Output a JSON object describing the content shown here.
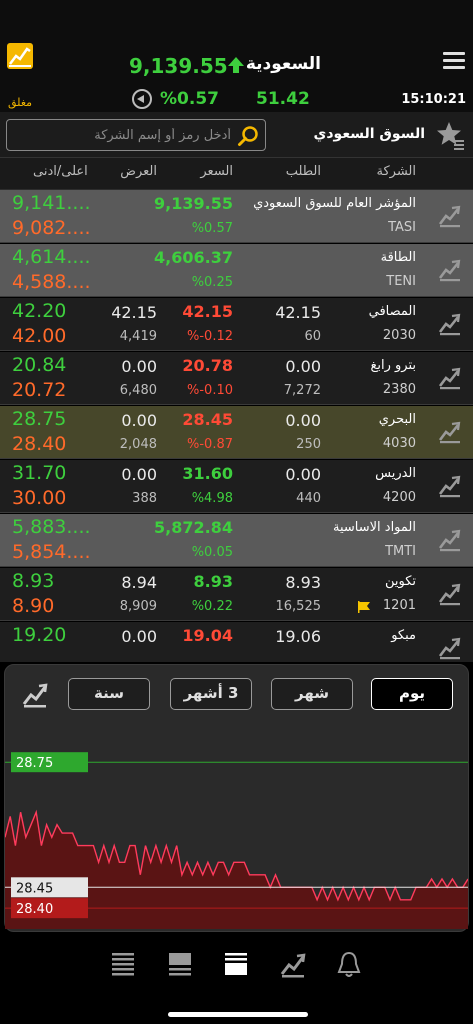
{
  "header": {
    "market_name": "السعودية",
    "index_value": "9,139.55",
    "status": "مغلق",
    "change_pct": "%0.57",
    "change_abs": "51.42",
    "time": "15:10:21"
  },
  "search": {
    "placeholder": "أدخل رمز أو إسم الشركة",
    "value": "",
    "market_selector": "السوق السعودي"
  },
  "columns": {
    "company": "الشركة",
    "bid": "الطلب",
    "price": "السعر",
    "ask": "العرض",
    "high_low": "اعلى/ادنى"
  },
  "rows": [
    {
      "name": "المؤشر العام للسوق السعودي",
      "code": "TASI",
      "bid": "",
      "bid_qty": "",
      "price": "9,139.55",
      "change": "%0.57",
      "ask": "",
      "ask_qty": "",
      "high": "9,141....",
      "low": "9,082....",
      "style": "idx",
      "dir": "up",
      "flag": false
    },
    {
      "name": "الطاقة",
      "code": "TENI",
      "bid": "",
      "bid_qty": "",
      "price": "4,606.37",
      "change": "%0.25",
      "ask": "",
      "ask_qty": "",
      "high": "4,614....",
      "low": "4,588....",
      "style": "idx",
      "dir": "up",
      "flag": false
    },
    {
      "name": "المصافي",
      "code": "2030",
      "bid": "42.15",
      "bid_qty": "60",
      "price": "42.15",
      "change": "%-0.12",
      "ask": "42.15",
      "ask_qty": "4,419",
      "high": "42.20",
      "low": "42.00",
      "style": "dark",
      "dir": "down",
      "flag": false
    },
    {
      "name": "بترو رابغ",
      "code": "2380",
      "bid": "0.00",
      "bid_qty": "7,272",
      "price": "20.78",
      "change": "%-0.10",
      "ask": "0.00",
      "ask_qty": "6,480",
      "high": "20.84",
      "low": "20.72",
      "style": "dark",
      "dir": "down",
      "flag": false
    },
    {
      "name": "البحري",
      "code": "4030",
      "bid": "0.00",
      "bid_qty": "250",
      "price": "28.45",
      "change": "%-0.87",
      "ask": "0.00",
      "ask_qty": "2,048",
      "high": "28.75",
      "low": "28.40",
      "style": "sel",
      "dir": "down",
      "flag": false
    },
    {
      "name": "الدريس",
      "code": "4200",
      "bid": "0.00",
      "bid_qty": "440",
      "price": "31.60",
      "change": "%4.98",
      "ask": "0.00",
      "ask_qty": "388",
      "high": "31.70",
      "low": "30.00",
      "style": "dark",
      "dir": "up",
      "flag": false
    },
    {
      "name": "المواد الاساسية",
      "code": "TMTI",
      "bid": "",
      "bid_qty": "",
      "price": "5,872.84",
      "change": "%0.05",
      "ask": "",
      "ask_qty": "",
      "high": "5,883....",
      "low": "5,854....",
      "style": "idx",
      "dir": "up",
      "flag": false
    },
    {
      "name": "تكوين",
      "code": "1201",
      "bid": "8.93",
      "bid_qty": "16,525",
      "price": "8.93",
      "change": "%0.22",
      "ask": "8.94",
      "ask_qty": "8,909",
      "high": "8.93",
      "low": "8.90",
      "style": "dark",
      "dir": "up",
      "flag": true
    },
    {
      "name": "مبكو",
      "code": "",
      "bid": "19.06",
      "bid_qty": "",
      "price": "19.04",
      "change": "",
      "ask": "0.00",
      "ask_qty": "",
      "high": "19.20",
      "low": "",
      "style": "dark",
      "dir": "down",
      "flag": false
    }
  ],
  "chart_panel": {
    "tabs": [
      "يوم",
      "شهر",
      "3 أشهر",
      "سنة"
    ],
    "active_tab": "يوم",
    "high_label": "28.75",
    "price_label": "28.45",
    "low_label": "28.40"
  },
  "chart_data": {
    "type": "area",
    "title": "",
    "xlabel": "",
    "ylabel": "",
    "ylim": [
      28.35,
      28.82
    ],
    "reference_lines": [
      28.75,
      28.45,
      28.4
    ],
    "values": [
      28.57,
      28.62,
      28.55,
      28.63,
      28.57,
      28.6,
      28.63,
      28.55,
      28.6,
      28.57,
      28.6,
      28.58,
      28.58,
      28.58,
      28.55,
      28.55,
      28.55,
      28.55,
      28.51,
      28.55,
      28.51,
      28.55,
      28.51,
      28.51,
      28.55,
      28.55,
      28.48,
      28.55,
      28.51,
      28.55,
      28.51,
      28.55,
      28.51,
      28.55,
      28.48,
      28.51,
      28.48,
      28.51,
      28.48,
      28.51,
      28.48,
      28.51,
      28.51,
      28.48,
      28.51,
      28.51,
      28.51,
      28.48,
      28.48,
      28.48,
      28.48,
      28.45,
      28.48,
      28.45,
      28.45,
      28.45,
      28.45,
      28.45,
      28.45,
      28.45,
      28.42,
      28.45,
      28.42,
      28.45,
      28.42,
      28.45,
      28.42,
      28.45,
      28.42,
      28.45,
      28.42,
      28.45,
      28.45,
      28.45,
      28.42,
      28.45,
      28.42,
      28.42,
      28.42,
      28.45,
      28.45,
      28.45,
      28.47,
      28.45,
      28.47,
      28.45,
      28.47,
      28.45,
      28.45,
      28.47
    ],
    "colors": {
      "line": "#ff3b5c",
      "fill": "#5a1414",
      "high": "#2ea82e",
      "price": "#e6e6e6",
      "low": "#b31b1b"
    }
  },
  "bottom_nav": [
    "list-icon",
    "watchlist-icon",
    "market-depth-icon",
    "chart-icon",
    "alerts-bell-icon"
  ],
  "colors": {
    "up": "#3ecf3e",
    "down": "#ff6a2a",
    "neg_price": "#ff4a36",
    "accent": "#f5b800"
  }
}
